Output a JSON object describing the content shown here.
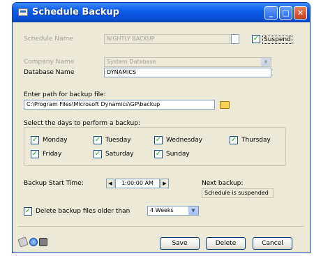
{
  "window": {
    "title": "Schedule Backup"
  },
  "form": {
    "schedule_name_label": "Schedule Name",
    "schedule_name_value": "NIGHTLY BACKUP",
    "suspend_label": "Suspend",
    "company_name_label": "Company Name",
    "company_name_value": "System Database",
    "database_name_label": "Database Name",
    "database_name_value": "DYNAMICS",
    "path_label": "Enter path for backup file:",
    "path_value": "C:\\Program Files\\Microsoft Dynamics\\GP\\backup",
    "days_label": "Select the days to perform a backup:",
    "days": [
      "Monday",
      "Tuesday",
      "Wednesday",
      "Thursday",
      "Friday",
      "Saturday",
      "Sunday"
    ],
    "start_time_label": "Backup Start Time:",
    "start_time_value": "1:00:00 AM",
    "next_backup_label": "Next backup:",
    "next_backup_value": "Schedule is suspended",
    "delete_label": "Delete backup files older than",
    "delete_value": "4 Weeks"
  },
  "buttons": {
    "save": "Save",
    "delete": "Delete",
    "cancel": "Cancel"
  }
}
